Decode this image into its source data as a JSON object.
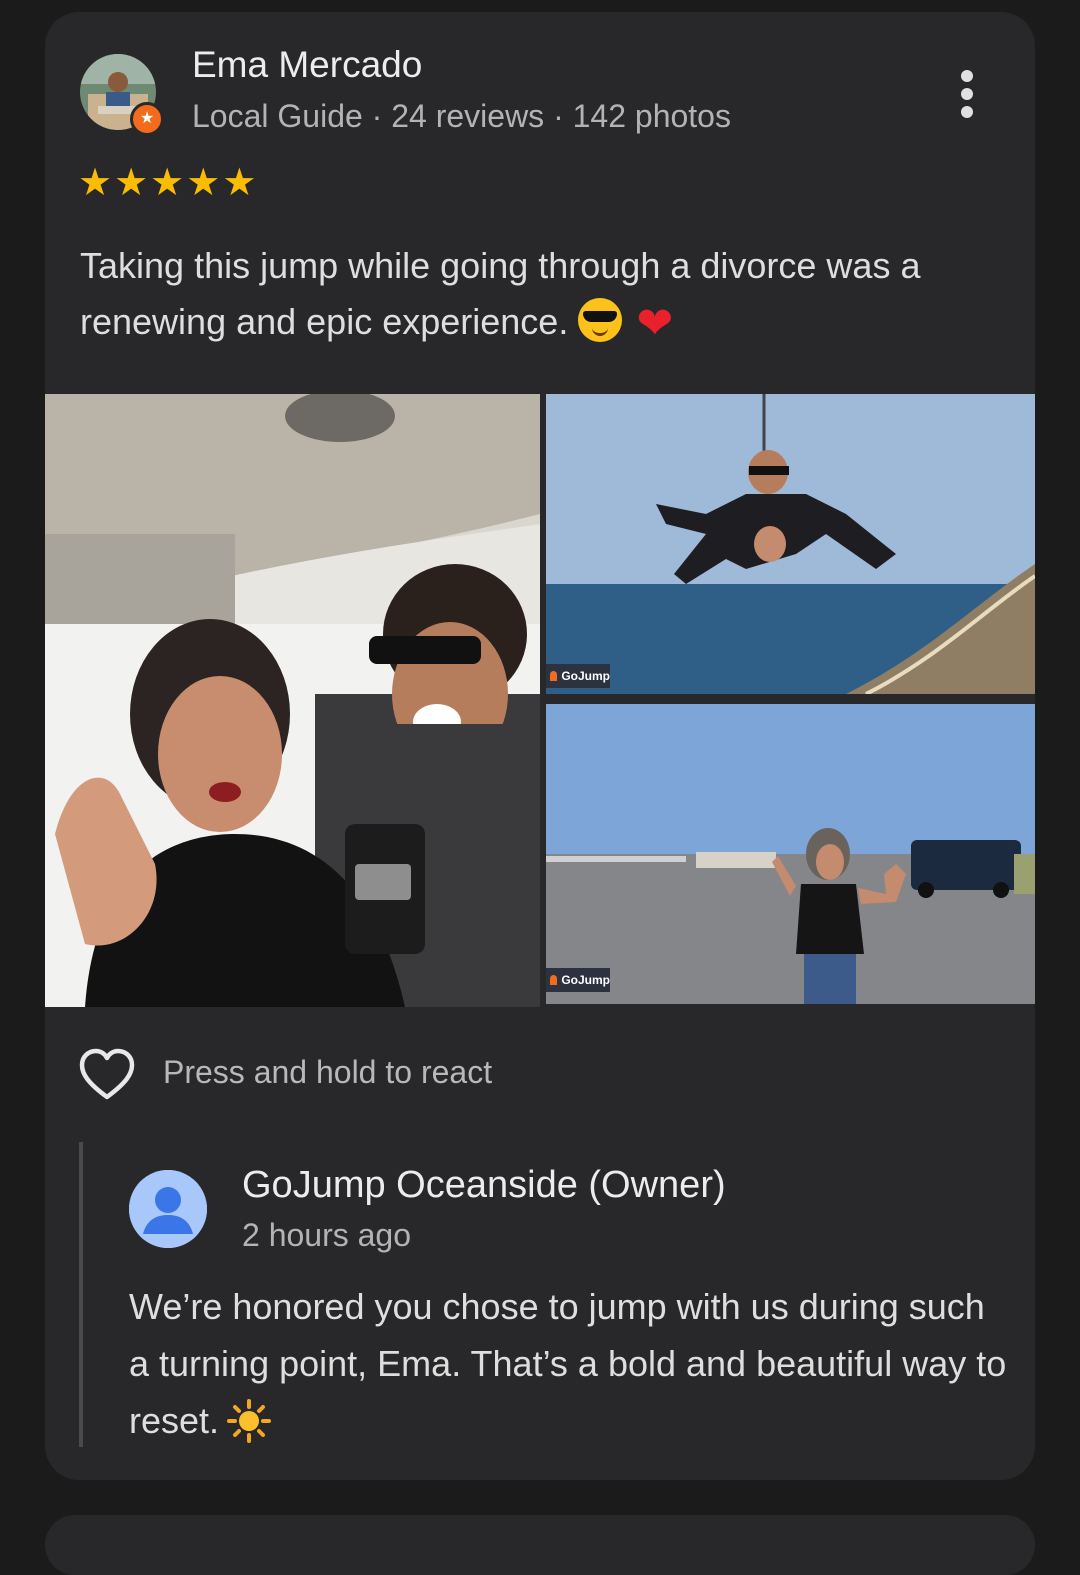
{
  "review": {
    "author": "Ema Mercado",
    "meta": "Local Guide · 24 reviews · 142 photos",
    "rating": 5,
    "stars": [
      "★",
      "★",
      "★",
      "★",
      "★"
    ],
    "text": "Taking this jump while going through a divorce was a renewing and epic experience."
  },
  "photos": {
    "watermark": "GoJump",
    "items": [
      "plane-selfie-photo",
      "freefall-tandem-photo",
      "runway-wave-photo"
    ]
  },
  "react": {
    "label": "Press and hold to react"
  },
  "owner_reply": {
    "name": "GoJump Oceanside (Owner)",
    "time": "2 hours ago",
    "text": "We’re honored you chose to jump with us during such a turning point, Ema. That’s a bold and beautiful way to reset."
  },
  "colors": {
    "background": "#1b1b1c",
    "card": "#28282a",
    "star": "#fbbc04",
    "local_guide_badge": "#f36b1c",
    "owner_avatar": "#a8c7fa"
  },
  "icons": {
    "menu": "more-vertical-icon",
    "react": "heart-outline-icon",
    "cool_emoji": "smiling-face-with-sunglasses-emoji",
    "heart_emoji": "red-heart-emoji",
    "sun_emoji": "sun-emoji"
  }
}
